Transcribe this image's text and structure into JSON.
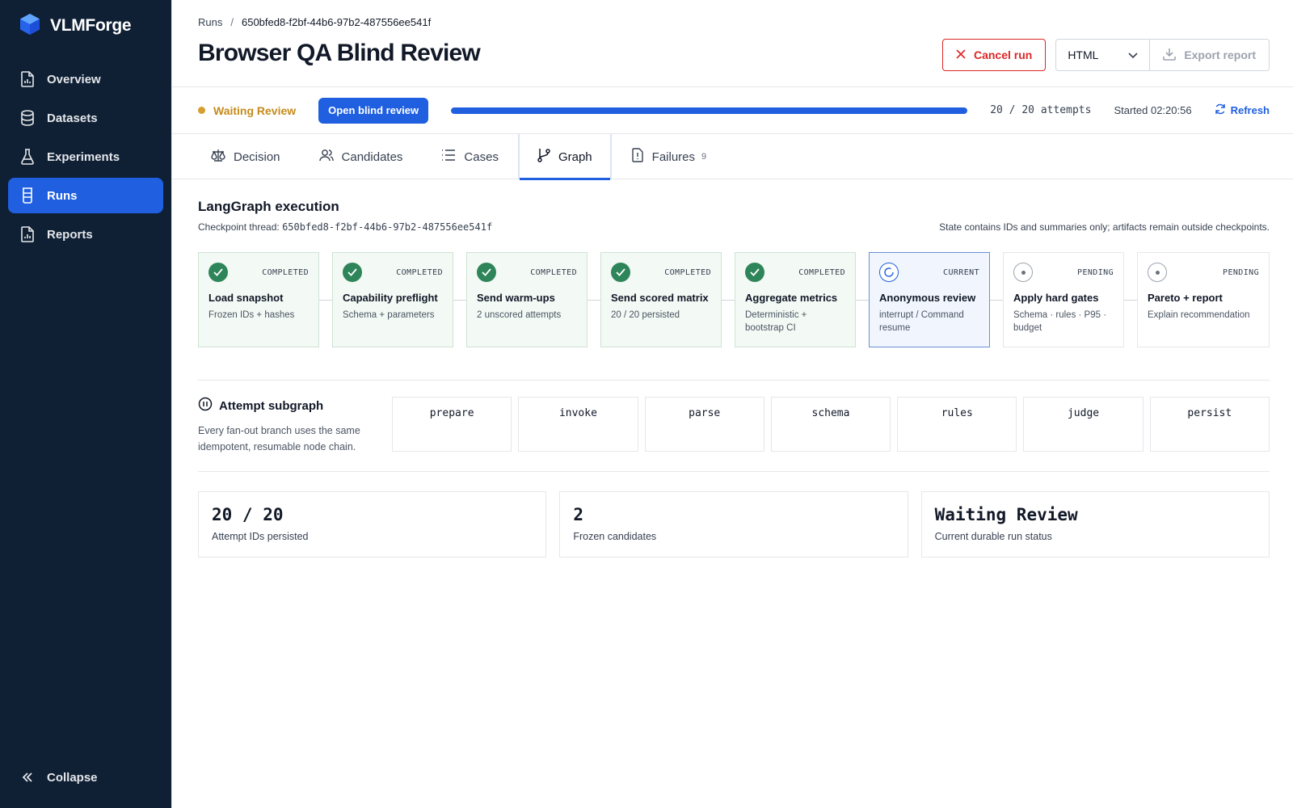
{
  "sidebar": {
    "brand": "VLMForge",
    "items": [
      {
        "label": "Overview",
        "icon": "chart-file-icon"
      },
      {
        "label": "Datasets",
        "icon": "database-icon"
      },
      {
        "label": "Experiments",
        "icon": "flask-icon"
      },
      {
        "label": "Runs",
        "icon": "beaker-icon",
        "active": true
      },
      {
        "label": "Reports",
        "icon": "report-file-icon"
      }
    ],
    "collapse_label": "Collapse"
  },
  "header": {
    "breadcrumb_root": "Runs",
    "breadcrumb_sep": "/",
    "breadcrumb_current": "650bfed8-f2bf-44b6-97b2-487556ee541f",
    "title": "Browser QA Blind Review",
    "cancel_label": "Cancel run",
    "format_value": "HTML",
    "export_label": "Export report"
  },
  "status_bar": {
    "status": "Waiting Review",
    "open_blind_label": "Open blind review",
    "progress_fraction": 1.0,
    "attempts": "20 / 20 attempts",
    "started": "Started 02:20:56",
    "refresh_label": "Refresh"
  },
  "tabs": [
    {
      "label": "Decision",
      "icon": "scale-icon"
    },
    {
      "label": "Candidates",
      "icon": "users-icon"
    },
    {
      "label": "Cases",
      "icon": "list-icon"
    },
    {
      "label": "Graph",
      "icon": "git-branch-icon",
      "active": true
    },
    {
      "label": "Failures",
      "icon": "alert-file-icon",
      "count": "9"
    }
  ],
  "graph": {
    "title": "LangGraph execution",
    "thread_label": "Checkpoint thread:",
    "thread_id": "650bfed8-f2bf-44b6-97b2-487556ee541f",
    "state_note": "State contains IDs and summaries only; artifacts remain outside checkpoints.",
    "nodes": [
      {
        "status": "COMPLETED",
        "title": "Load snapshot",
        "sub": "Frozen IDs + hashes"
      },
      {
        "status": "COMPLETED",
        "title": "Capability preflight",
        "sub": "Schema + parameters"
      },
      {
        "status": "COMPLETED",
        "title": "Send warm-ups",
        "sub": "2 unscored attempts"
      },
      {
        "status": "COMPLETED",
        "title": "Send scored matrix",
        "sub": "20 / 20 persisted"
      },
      {
        "status": "COMPLETED",
        "title": "Aggregate metrics",
        "sub": "Deterministic + bootstrap CI"
      },
      {
        "status": "CURRENT",
        "title": "Anonymous review",
        "sub": "interrupt / Command resume"
      },
      {
        "status": "PENDING",
        "title": "Apply hard gates",
        "sub": "Schema · rules · P95 · budget"
      },
      {
        "status": "PENDING",
        "title": "Pareto + report",
        "sub": "Explain recommendation"
      }
    ]
  },
  "subgraph": {
    "title": "Attempt subgraph",
    "desc": "Every fan-out branch uses the same idempotent, resumable node chain.",
    "steps": [
      "prepare",
      "invoke",
      "parse",
      "schema",
      "rules",
      "judge",
      "persist"
    ]
  },
  "stats": [
    {
      "value": "20 / 20",
      "label": "Attempt IDs persisted"
    },
    {
      "value": "2",
      "label": "Frozen candidates"
    },
    {
      "value": "Waiting Review",
      "label": "Current durable run status"
    }
  ]
}
